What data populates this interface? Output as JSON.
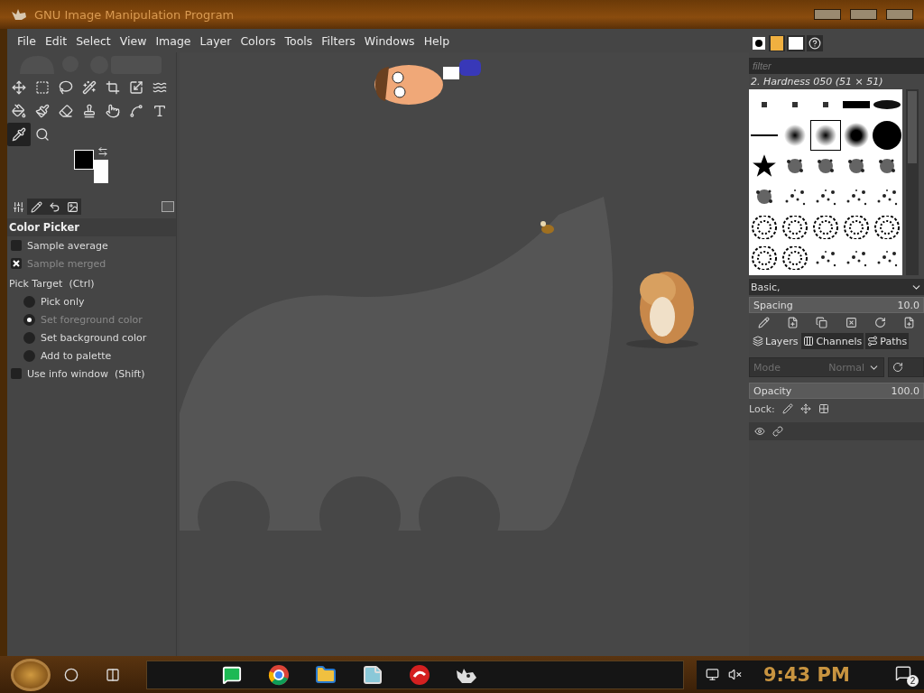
{
  "window": {
    "title": "GNU Image Manipulation Program"
  },
  "menu": [
    "File",
    "Edit",
    "Select",
    "View",
    "Image",
    "Layer",
    "Colors",
    "Tools",
    "Filters",
    "Windows",
    "Help"
  ],
  "toolbox": {
    "tools": [
      {
        "kind": "move",
        "selected": false
      },
      {
        "kind": "rect",
        "selected": false
      },
      {
        "kind": "lasso",
        "selected": false
      },
      {
        "kind": "wand",
        "selected": false
      },
      {
        "kind": "crop",
        "selected": false
      },
      {
        "kind": "transform",
        "selected": false
      },
      {
        "kind": "warp",
        "selected": false
      },
      {
        "kind": "bucket",
        "selected": false
      },
      {
        "kind": "brush",
        "selected": false
      },
      {
        "kind": "eraser",
        "selected": false
      },
      {
        "kind": "clone",
        "selected": false
      },
      {
        "kind": "smudge",
        "selected": false
      },
      {
        "kind": "paths",
        "selected": false
      },
      {
        "kind": "text",
        "selected": false
      },
      {
        "kind": "picker",
        "selected": true
      },
      {
        "kind": "zoom",
        "selected": false
      }
    ]
  },
  "dock_tabs": [
    {
      "kind": "options",
      "selected": true
    },
    {
      "kind": "device",
      "selected": false
    },
    {
      "kind": "undo",
      "selected": false
    },
    {
      "kind": "images",
      "selected": false
    }
  ],
  "tool_options": {
    "title": "Color Picker",
    "options": [
      {
        "kind": "check",
        "label": "Sample average",
        "checked": false,
        "disabled": false
      },
      {
        "kind": "check",
        "label": "Sample merged",
        "checked": true,
        "disabled": true
      },
      {
        "kind": "heading",
        "label": "Pick Target  (Ctrl)"
      },
      {
        "kind": "radio",
        "label": "Pick only",
        "selected": false
      },
      {
        "kind": "radio",
        "label": "Set foreground color",
        "selected": true
      },
      {
        "kind": "radio",
        "label": "Set background color",
        "selected": false
      },
      {
        "kind": "radio",
        "label": "Add to palette",
        "selected": false
      },
      {
        "kind": "check",
        "label": "Use info window  (Shift)",
        "checked": false,
        "disabled": false
      }
    ]
  },
  "brushes": {
    "tabs": [
      {
        "kind": "brush",
        "selected": true
      },
      {
        "kind": "pattern",
        "selected": false
      },
      {
        "kind": "font",
        "selected": false
      },
      {
        "kind": "help",
        "selected": false
      }
    ],
    "filter": {
      "placeholder": "filter"
    },
    "name": "2. Hardness 050 (51 × 51)",
    "items": [
      {
        "kind": "dot",
        "selected": false
      },
      {
        "kind": "dot",
        "selected": false
      },
      {
        "kind": "dot",
        "selected": false
      },
      {
        "kind": "bar",
        "selected": false
      },
      {
        "kind": "oval",
        "selected": false
      },
      {
        "kind": "line",
        "selected": false
      },
      {
        "kind": "soft",
        "selected": false
      },
      {
        "kind": "soft",
        "selected": true
      },
      {
        "kind": "medium",
        "selected": false
      },
      {
        "kind": "hard",
        "selected": false
      },
      {
        "kind": "star",
        "selected": false
      },
      {
        "kind": "splatter",
        "selected": false
      },
      {
        "kind": "splatter",
        "selected": false
      },
      {
        "kind": "splatter",
        "selected": false
      },
      {
        "kind": "splatter",
        "selected": false
      },
      {
        "kind": "splatter",
        "selected": false
      },
      {
        "kind": "scatter",
        "selected": false
      },
      {
        "kind": "scatter",
        "selected": false
      },
      {
        "kind": "scatter",
        "selected": false
      },
      {
        "kind": "scatter",
        "selected": false
      },
      {
        "kind": "texture",
        "selected": false
      },
      {
        "kind": "texture",
        "selected": false
      },
      {
        "kind": "texture",
        "selected": false
      },
      {
        "kind": "texture",
        "selected": false
      },
      {
        "kind": "texture",
        "selected": false
      },
      {
        "kind": "texture",
        "selected": false
      },
      {
        "kind": "texture",
        "selected": false
      },
      {
        "kind": "scatter",
        "selected": false
      },
      {
        "kind": "scatter",
        "selected": false
      },
      {
        "kind": "scatter",
        "selected": false
      }
    ],
    "preset": "Basic,",
    "spacing": {
      "label": "Spacing",
      "value": "10.0",
      "level": 1
    }
  },
  "layers": {
    "tabs": [
      {
        "label": "Layers",
        "selected": true
      },
      {
        "label": "Channels",
        "selected": false
      },
      {
        "label": "Paths",
        "selected": false
      }
    ],
    "mode": {
      "placeholder": "Mode",
      "value": "Normal"
    },
    "opacity": {
      "label": "Opacity",
      "value": "100.0",
      "level": 1
    },
    "lock": "Lock:"
  },
  "taskbar": {
    "apps": [
      {
        "kind": "chat"
      },
      {
        "kind": "browser"
      },
      {
        "kind": "folder"
      },
      {
        "kind": "notes"
      },
      {
        "kind": "red"
      },
      {
        "kind": "gimp"
      }
    ],
    "clock": "9:43 PM",
    "notifications": "2"
  }
}
